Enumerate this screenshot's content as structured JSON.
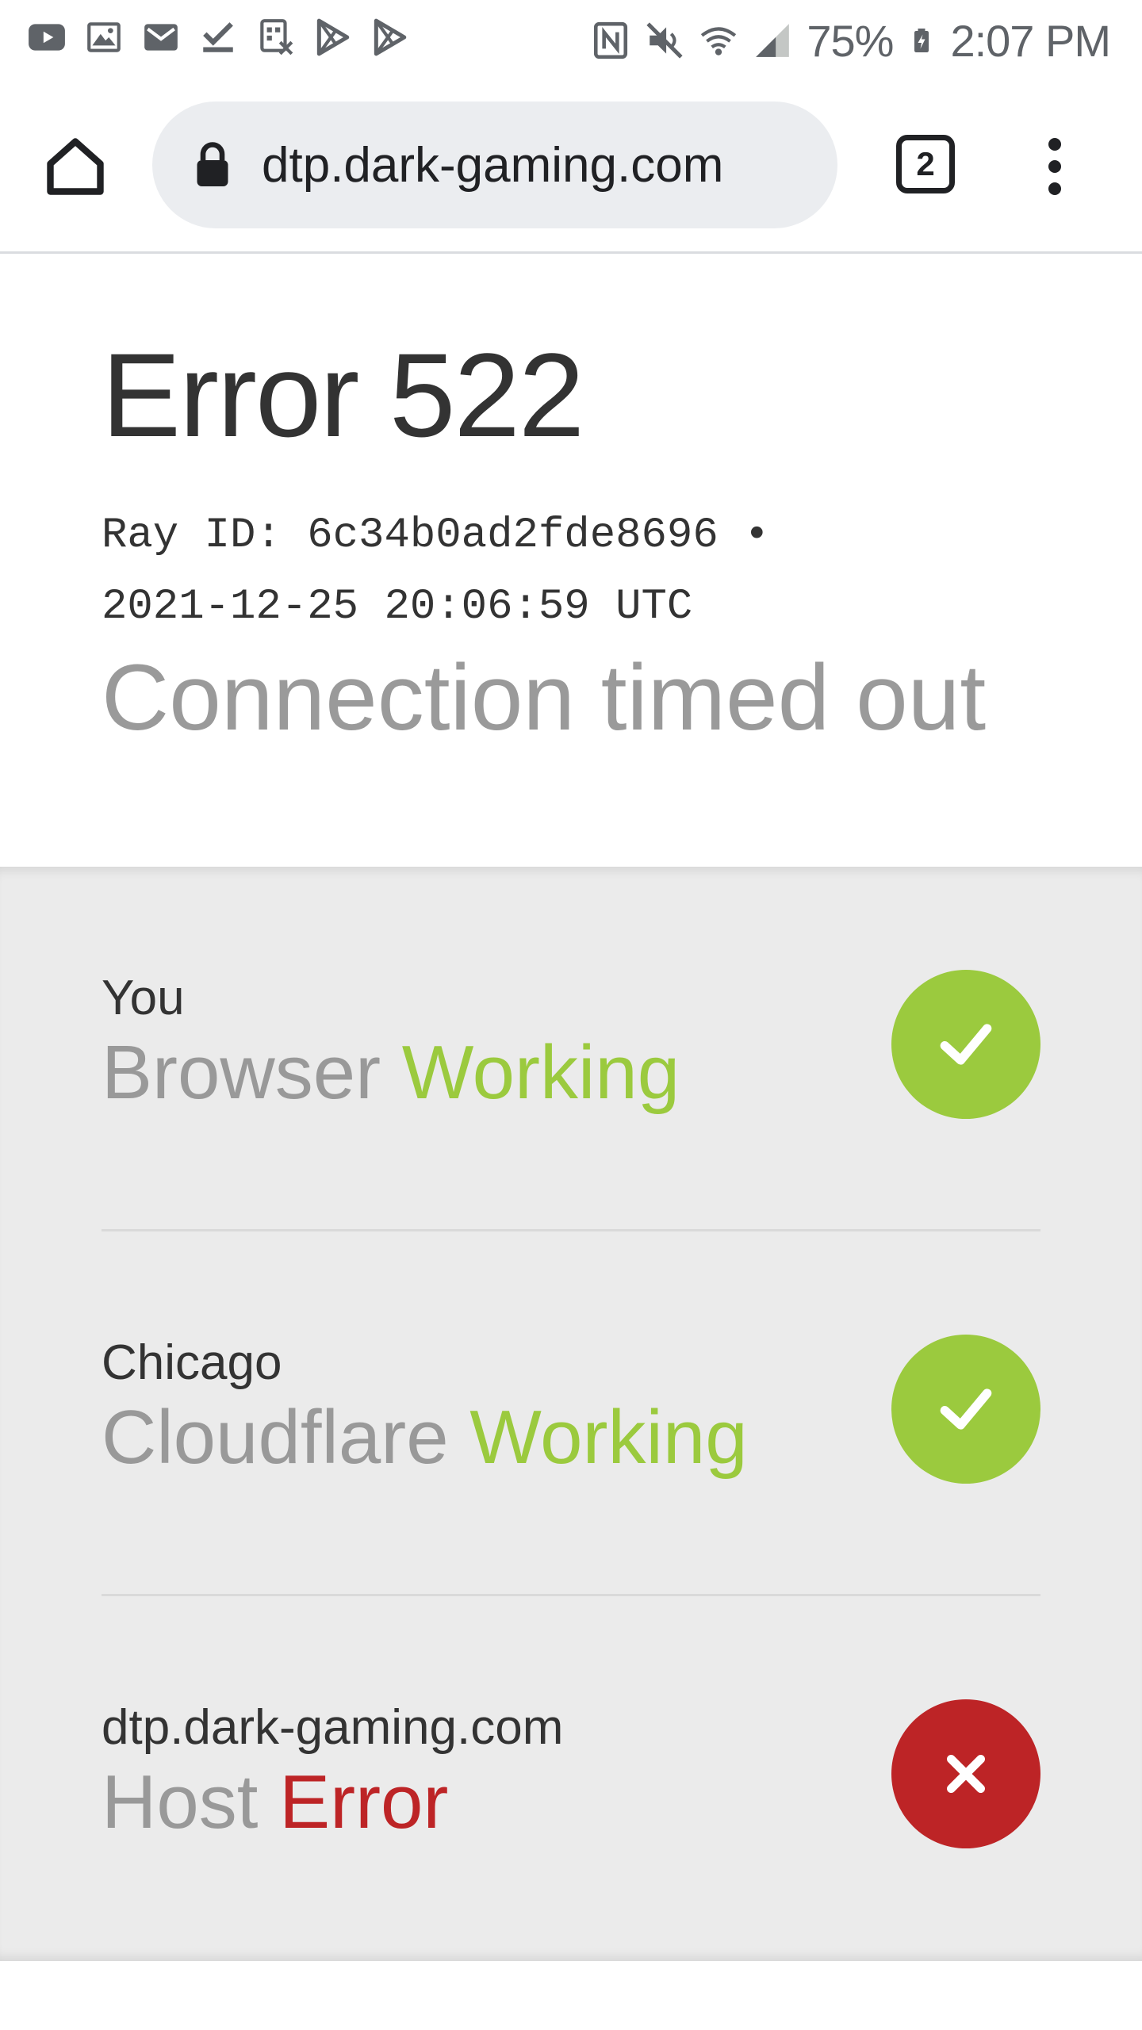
{
  "status_bar": {
    "battery": "75%",
    "time": "2:07 PM",
    "left_icons": [
      "youtube-icon",
      "gallery-icon",
      "email-icon",
      "task-check-icon",
      "screenshot-icon",
      "play-store-icon",
      "play-store-icon"
    ],
    "right_icons": [
      "nfc-icon",
      "mute-icon",
      "wifi-icon",
      "signal-icon",
      "battery-charging-icon"
    ]
  },
  "browser": {
    "url": "dtp.dark-gaming.com",
    "tab_count": "2"
  },
  "error": {
    "title": "Error 522",
    "ray_id_line": "Ray ID: 6c34b0ad2fde8696 •",
    "timestamp_line": "2021-12-25 20:06:59 UTC",
    "subtitle": "Connection timed out"
  },
  "status_items": [
    {
      "location": "You",
      "name": "Browser",
      "status": "Working",
      "state": "ok"
    },
    {
      "location": "Chicago",
      "name": "Cloudflare",
      "status": "Working",
      "state": "ok"
    },
    {
      "location": "dtp.dark-gaming.com",
      "name": "Host",
      "status": "Error",
      "state": "error"
    }
  ],
  "colors": {
    "working": "#9bca3e",
    "error": "#bd2426",
    "panel_bg": "#ebebeb"
  }
}
